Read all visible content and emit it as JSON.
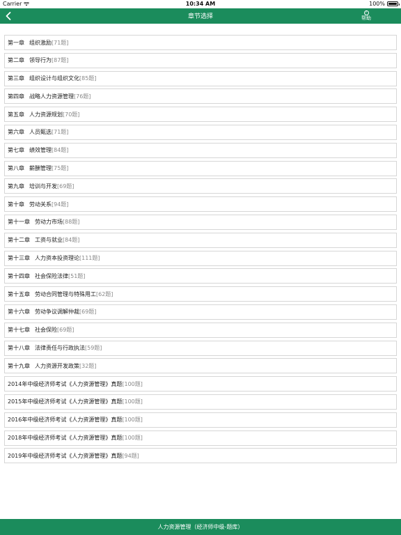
{
  "status_bar": {
    "carrier": "Carrier",
    "time": "10:34 AM",
    "battery": "100%"
  },
  "nav": {
    "title": "章节选择",
    "help_label": "帮助",
    "help_icon": "?"
  },
  "chapters": [
    {
      "num": "第一章",
      "name": "组织激励",
      "count": "[71题]"
    },
    {
      "num": "第二章",
      "name": "领导行为",
      "count": "[87题]"
    },
    {
      "num": "第三章",
      "name": "组织设计与组织文化",
      "count": "[85题]"
    },
    {
      "num": "第四章",
      "name": "战略人力资源管理",
      "count": "[76题]"
    },
    {
      "num": "第五章",
      "name": "人力资源规划",
      "count": "[70题]"
    },
    {
      "num": "第六章",
      "name": "人员甄选",
      "count": "[71题]"
    },
    {
      "num": "第七章",
      "name": "绩效管理",
      "count": "[84题]"
    },
    {
      "num": "第八章",
      "name": "薪酬管理",
      "count": "[75题]"
    },
    {
      "num": "第九章",
      "name": "培训与开发",
      "count": "[69题]"
    },
    {
      "num": "第十章",
      "name": "劳动关系",
      "count": "[94题]"
    },
    {
      "num": "第十一章",
      "name": "劳动力市场",
      "count": "[88题]"
    },
    {
      "num": "第十二章",
      "name": "工资与就业",
      "count": "[84题]"
    },
    {
      "num": "第十三章",
      "name": "人力资本投资理论",
      "count": "[111题]"
    },
    {
      "num": "第十四章",
      "name": "社会保险法律",
      "count": "[51题]"
    },
    {
      "num": "第十五章",
      "name": "劳动合同管理与特殊用工",
      "count": "[62题]"
    },
    {
      "num": "第十六章",
      "name": "劳动争议调解仲裁",
      "count": "[69题]"
    },
    {
      "num": "第十七章",
      "name": "社会保险",
      "count": "[69题]"
    },
    {
      "num": "第十八章",
      "name": "法律责任与行政执法",
      "count": "[59题]"
    },
    {
      "num": "第十九章",
      "name": "人力资源开发政策",
      "count": "[32题]"
    },
    {
      "num": "",
      "name": "2014年中级经济师考试《人力资源管理》真题",
      "count": "[100题]"
    },
    {
      "num": "",
      "name": "2015年中级经济师考试《人力资源管理》真题",
      "count": "[100题]"
    },
    {
      "num": "",
      "name": "2016年中级经济师考试《人力资源管理》真题",
      "count": "[100题]"
    },
    {
      "num": "",
      "name": "2018年中级经济师考试《人力资源管理》真题",
      "count": "[100题]"
    },
    {
      "num": "",
      "name": "2019年中级经济师考试《人力资源管理》真题",
      "count": "[94题]"
    }
  ],
  "footer": {
    "text": "人力资源管理（经济师中级-题库）"
  },
  "colors": {
    "accent": "#1b8c5c"
  }
}
